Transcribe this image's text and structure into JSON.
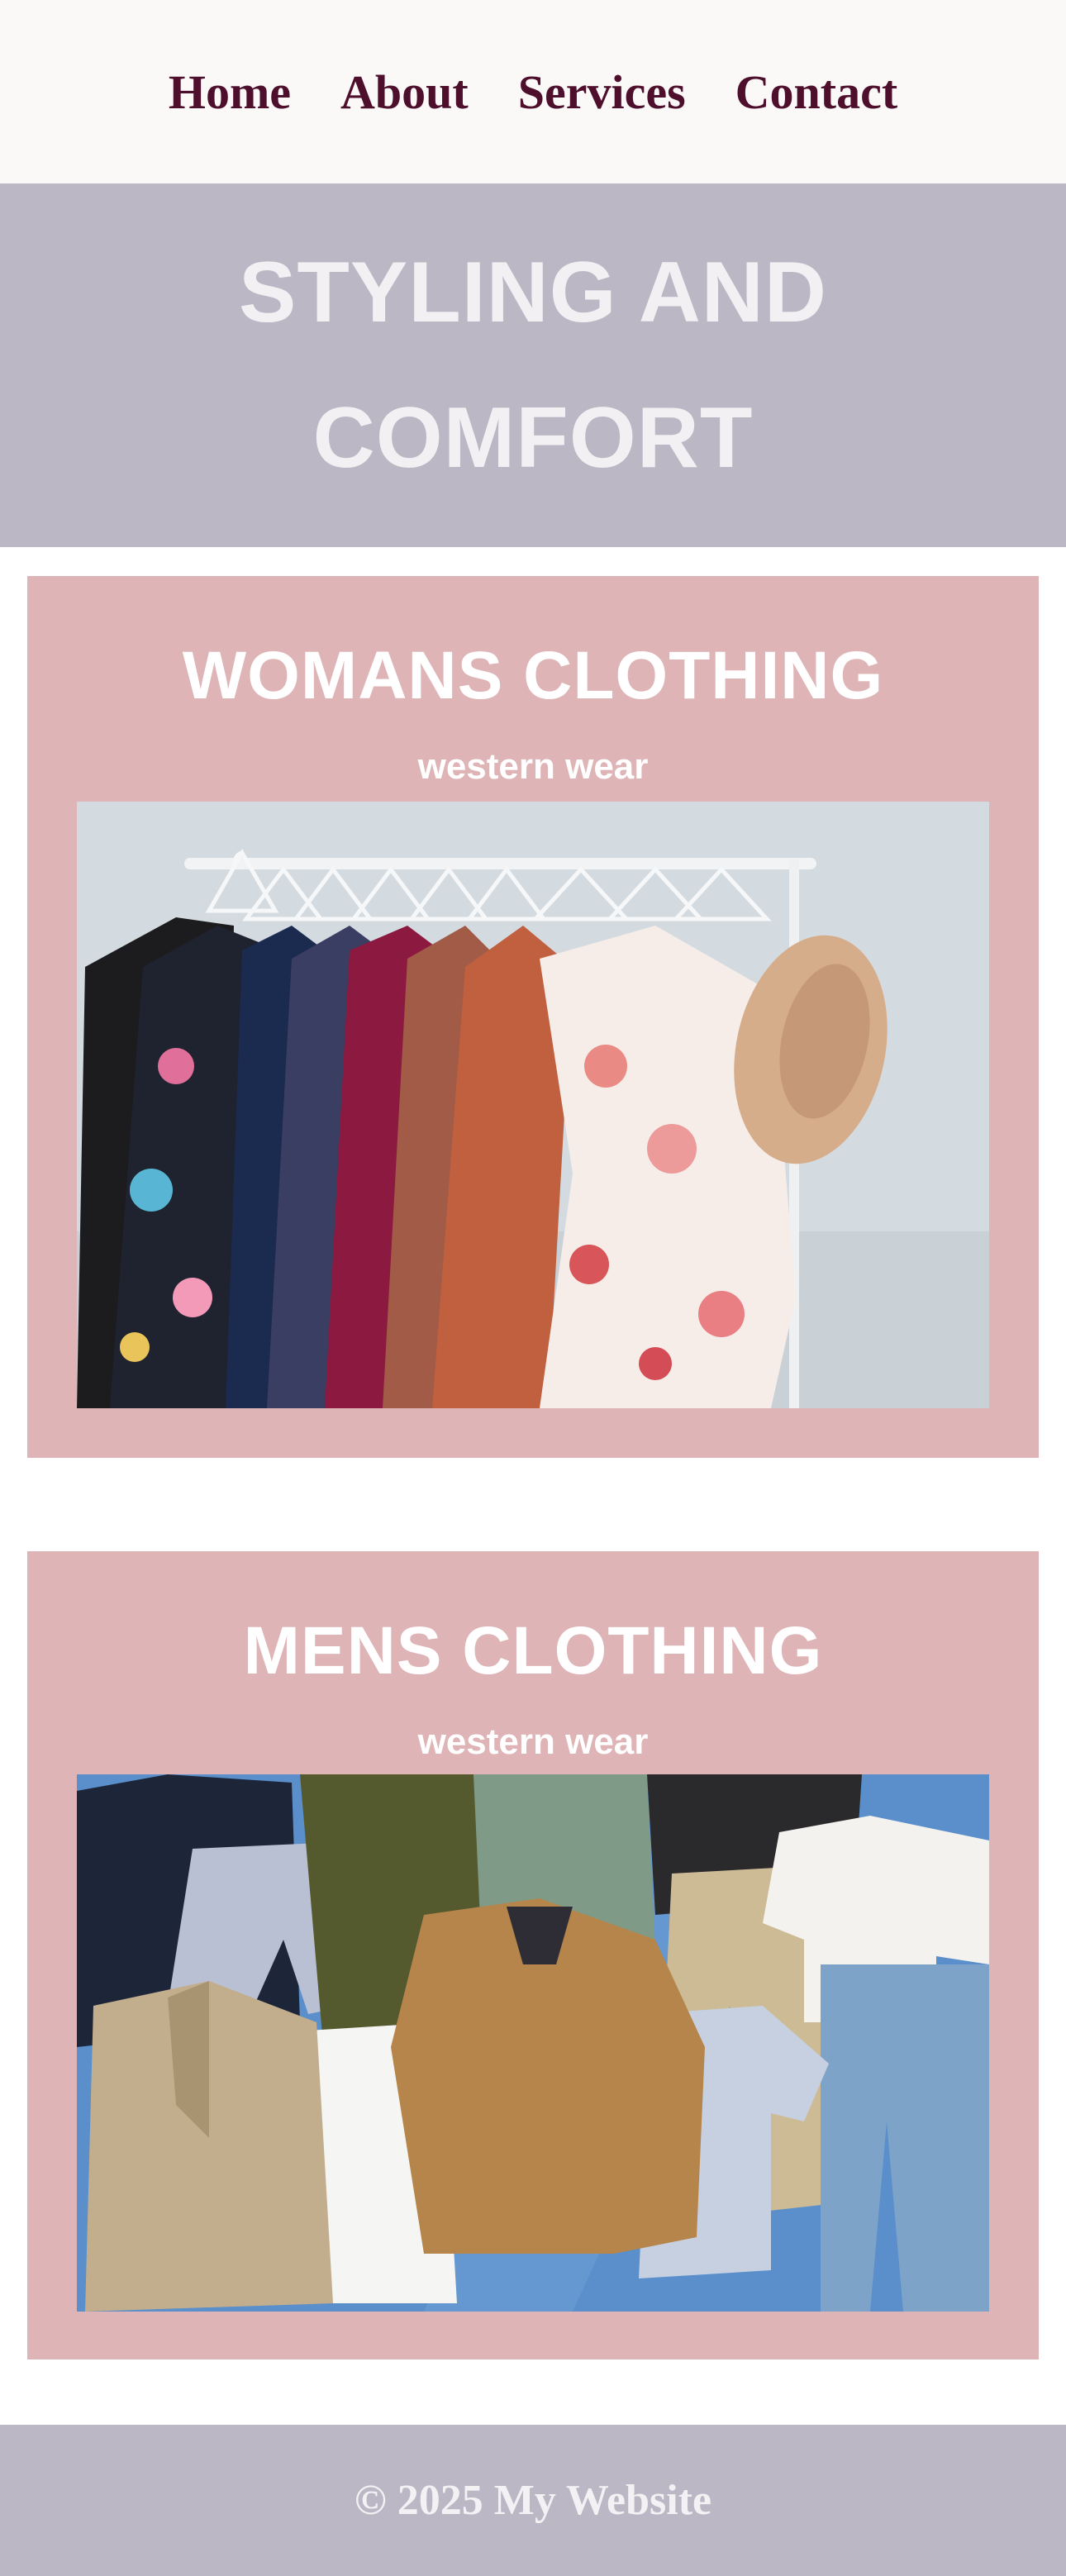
{
  "nav": {
    "items": [
      {
        "label": "Home"
      },
      {
        "label": "About"
      },
      {
        "label": "Services"
      },
      {
        "label": "Contact"
      }
    ]
  },
  "hero": {
    "title": "STYLING AND COMFORT"
  },
  "womens": {
    "title": "WOMANS CLOTHING",
    "subtitle": "western wear"
  },
  "mens": {
    "title": "MENS CLOTHING",
    "subtitle": "western wear"
  },
  "footer": {
    "text": "© 2025 My Website"
  },
  "colors": {
    "nav_bg": "#fbf9f8",
    "nav_link": "#4e0f2c",
    "hero_bg": "#bbb7c5",
    "card_bg": "#dfb4b6",
    "footer_bg": "#bbb7c5"
  }
}
